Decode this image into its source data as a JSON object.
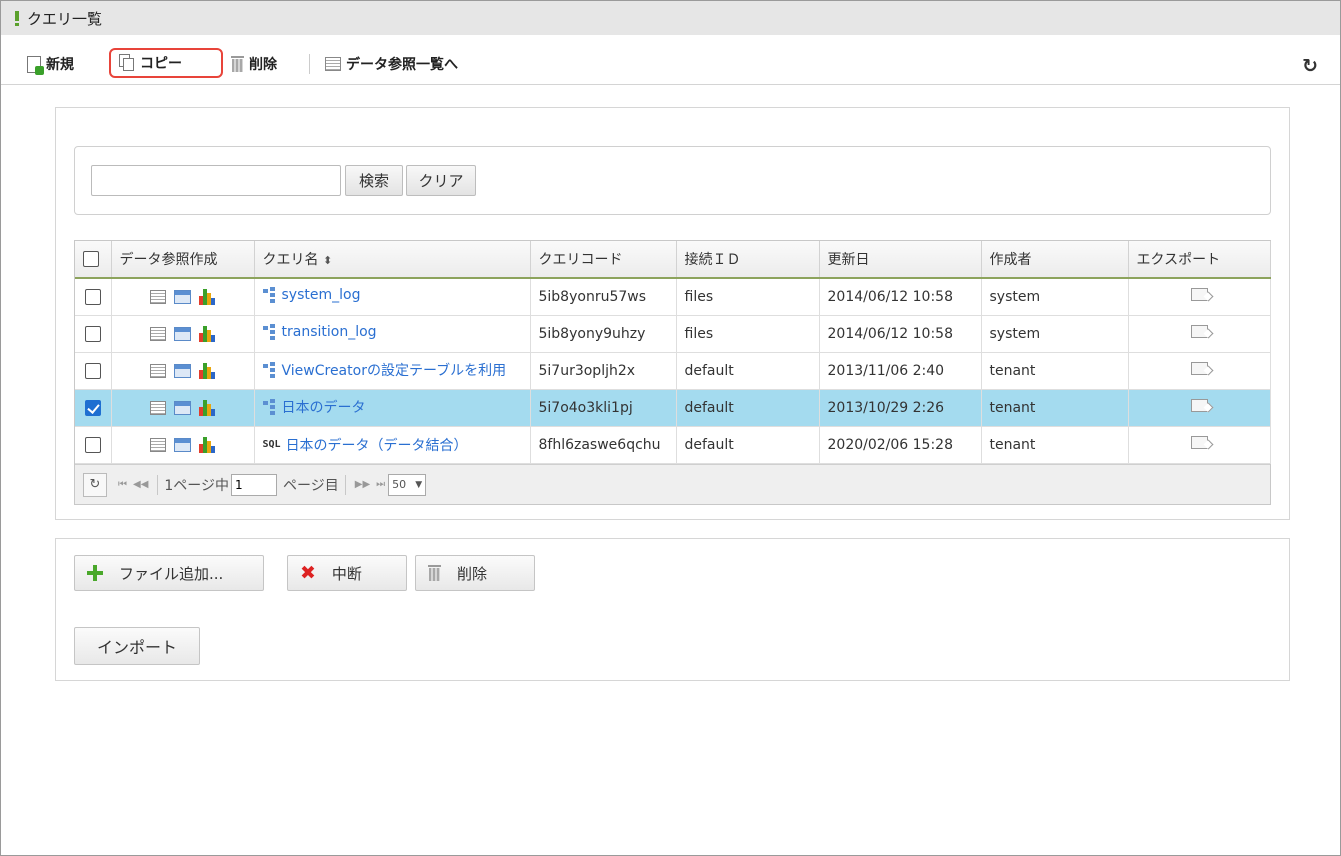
{
  "window": {
    "title": "クエリ一覧"
  },
  "toolbar": {
    "new_label": "新規",
    "copy_label": "コピー",
    "delete_label": "削除",
    "data_ref_label": "データ参照一覧へ",
    "refresh_icon": "↻"
  },
  "search": {
    "value": "",
    "search_label": "検索",
    "clear_label": "クリア"
  },
  "table": {
    "columns": [
      "データ参照作成",
      "クエリ名",
      "クエリコード",
      "接続ＩＤ",
      "更新日",
      "作成者",
      "エクスポート"
    ],
    "sort_indicator": "⬍",
    "rows": [
      {
        "checked": false,
        "type_icon": "tree-icon",
        "name": "system_log",
        "code": "5ib8yonru57ws",
        "conn": "files",
        "updated": "2014/06/12 10:58",
        "author": "system"
      },
      {
        "checked": false,
        "type_icon": "tree-icon",
        "name": "transition_log",
        "code": "5ib8yony9uhzy",
        "conn": "files",
        "updated": "2014/06/12 10:58",
        "author": "system"
      },
      {
        "checked": false,
        "type_icon": "tree-icon",
        "name": "ViewCreatorの設定テーブルを利用",
        "code": "5i7ur3opljh2x",
        "conn": "default",
        "updated": "2013/11/06 2:40",
        "author": "tenant"
      },
      {
        "checked": true,
        "type_icon": "tree-icon",
        "name": "日本のデータ",
        "code": "5i7o4o3kli1pj",
        "conn": "default",
        "updated": "2013/10/29 2:26",
        "author": "tenant"
      },
      {
        "checked": false,
        "type_icon": "sql-tag",
        "type_tag": "SQL",
        "name": "日本のデータ（データ結合）",
        "code": "8fhl6zaswe6qchu",
        "conn": "default",
        "updated": "2020/02/06 15:28",
        "author": "tenant"
      }
    ]
  },
  "pager": {
    "refresh_icon": "↻",
    "first_icon": "⏮",
    "prev_icon": "◀◀",
    "total_label": "1ページ中",
    "current_page": "1",
    "page_suffix": "ページ目",
    "next_icon": "▶▶",
    "last_icon": "⏭",
    "page_size": "50"
  },
  "upload": {
    "add_label": "ファイル追加...",
    "stop_label": "中断",
    "delete_label": "削除",
    "import_label": "インポート"
  },
  "colors": {
    "link": "#2a6fd1",
    "selected_row": "#a4dbef",
    "highlight_border": "#e8443a",
    "accent_green": "#5aa02c"
  }
}
